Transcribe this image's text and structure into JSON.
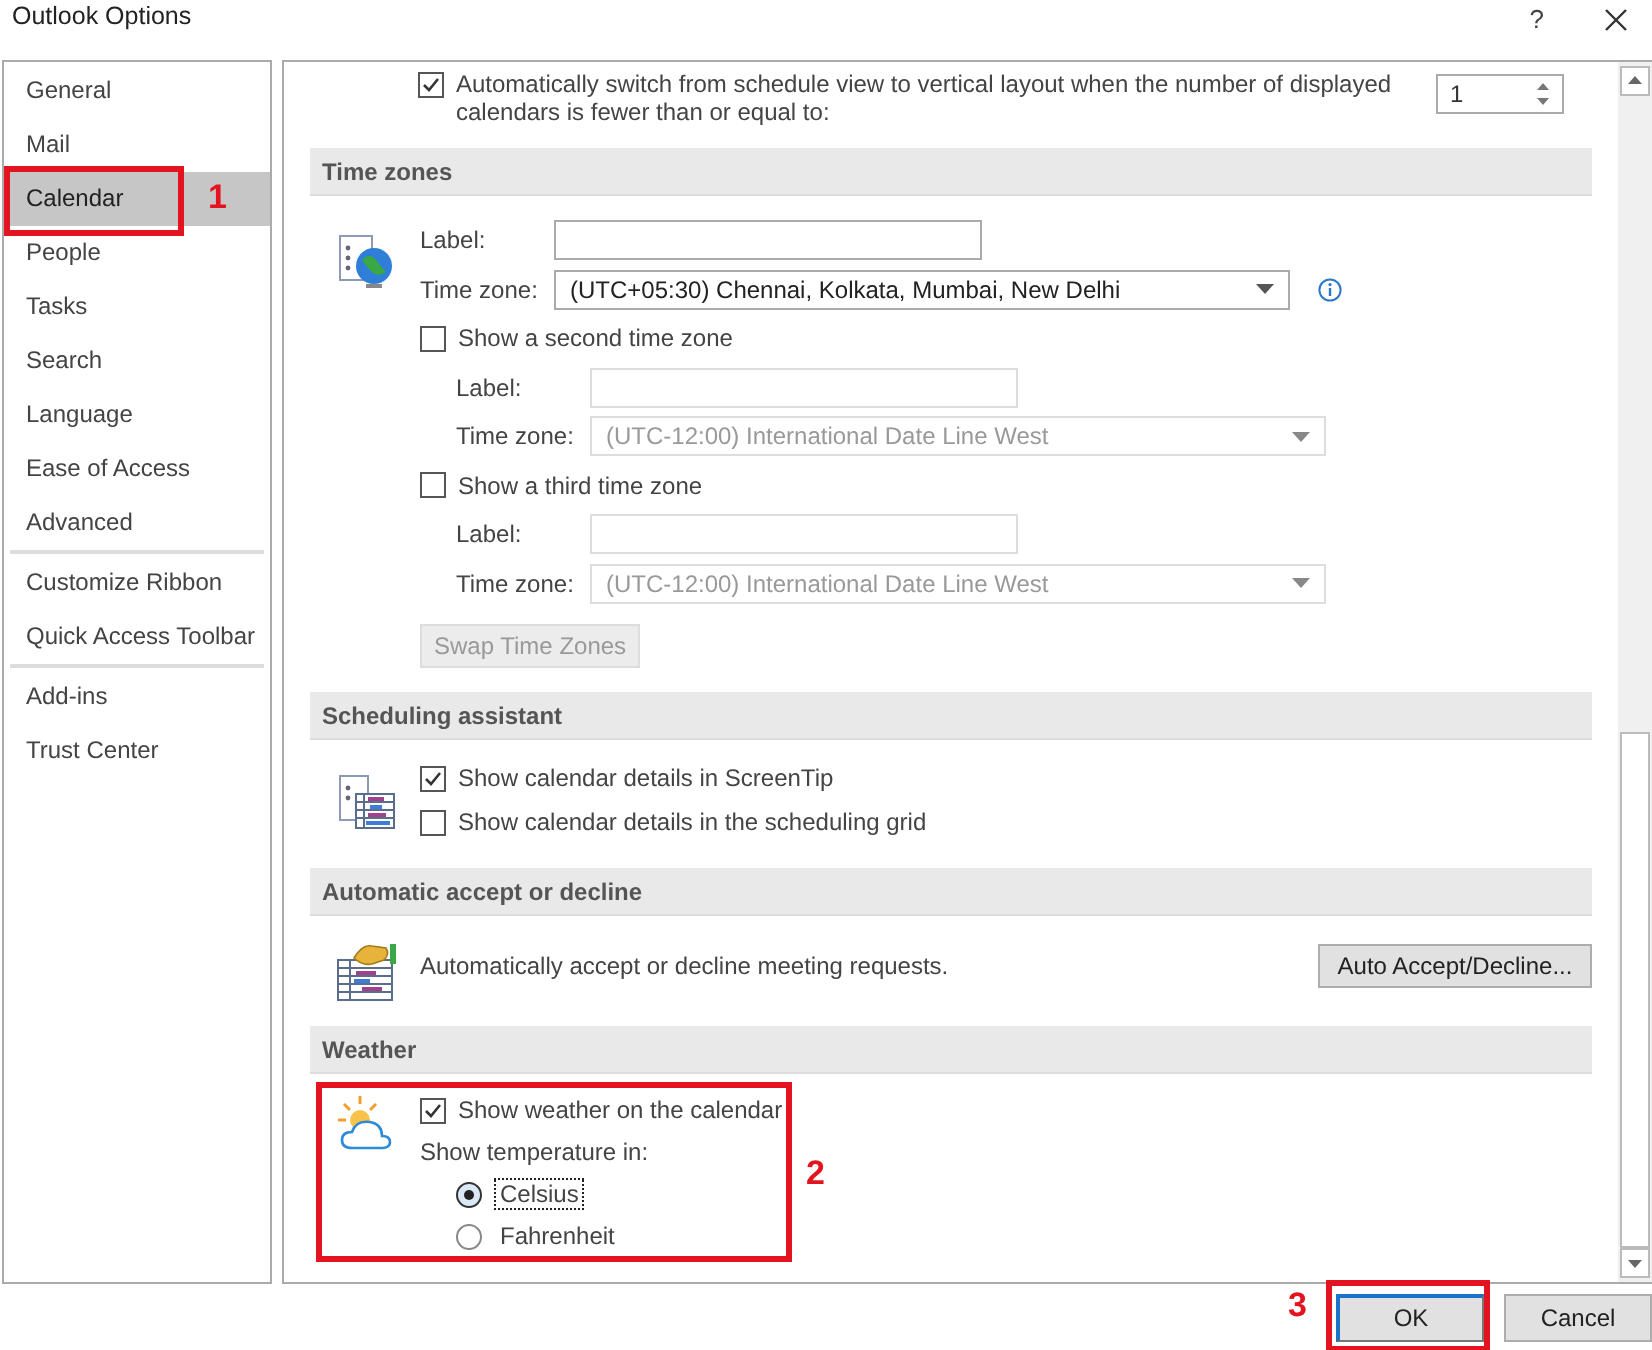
{
  "window": {
    "title": "Outlook Options",
    "help": "?"
  },
  "sidebar": {
    "groups": [
      [
        {
          "label": "General",
          "selected": false
        },
        {
          "label": "Mail",
          "selected": false
        },
        {
          "label": "Calendar",
          "selected": true,
          "annotation": "1"
        },
        {
          "label": "People",
          "selected": false
        },
        {
          "label": "Tasks",
          "selected": false
        },
        {
          "label": "Search",
          "selected": false
        },
        {
          "label": "Language",
          "selected": false
        },
        {
          "label": "Ease of Access",
          "selected": false
        },
        {
          "label": "Advanced",
          "selected": false
        }
      ],
      [
        {
          "label": "Customize Ribbon",
          "selected": false
        },
        {
          "label": "Quick Access Toolbar",
          "selected": false
        }
      ],
      [
        {
          "label": "Add-ins",
          "selected": false
        },
        {
          "label": "Trust Center",
          "selected": false
        }
      ]
    ]
  },
  "top_option": {
    "label": "Automatically switch from schedule view to vertical layout when the number of displayed calendars is fewer than or equal to:",
    "checked": true,
    "spinner": "1"
  },
  "sections": [
    {
      "title": "Time zones",
      "rows": [
        {
          "kind": "field",
          "label": "Label:",
          "disabled": false
        },
        {
          "kind": "select",
          "label": "Time zone:",
          "value": "(UTC+05:30) Chennai, Kolkata, Mumbai, New Delhi",
          "disabled": false,
          "info": true
        },
        {
          "kind": "checkbox",
          "label": "Show a second time zone",
          "checked": false,
          "children": [
            {
              "kind": "field",
              "label": "Label:",
              "disabled": true
            },
            {
              "kind": "select",
              "label": "Time zone:",
              "value": "(UTC-12:00) International Date Line West",
              "disabled": true
            }
          ]
        },
        {
          "kind": "checkbox",
          "label": "Show a third time zone",
          "checked": false,
          "children": [
            {
              "kind": "field",
              "label": "Label:",
              "disabled": true
            },
            {
              "kind": "select",
              "label": "Time zone:",
              "value": "(UTC-12:00) International Date Line West",
              "disabled": true
            }
          ]
        },
        {
          "kind": "button",
          "label": "Swap Time Zones",
          "disabled": true
        }
      ]
    },
    {
      "title": "Scheduling assistant",
      "rows": [
        {
          "kind": "checkbox",
          "label": "Show calendar details in ScreenTip",
          "checked": true
        },
        {
          "kind": "checkbox",
          "label": "Show calendar details in the scheduling grid",
          "checked": false
        }
      ]
    },
    {
      "title": "Automatic accept or decline",
      "rows": [
        {
          "kind": "text",
          "label": "Automatically accept or decline meeting requests.",
          "button": "Auto Accept/Decline..."
        }
      ]
    },
    {
      "title": "Weather",
      "annotation": "2",
      "rows": [
        {
          "kind": "checkbox",
          "label": "Show weather on the calendar",
          "checked": true
        },
        {
          "kind": "text",
          "label": "Show temperature in:",
          "children": [
            {
              "kind": "radio",
              "label": "Celsius",
              "selected": true,
              "focused": true
            },
            {
              "kind": "radio",
              "label": "Fahrenheit",
              "selected": false,
              "focused": false
            }
          ]
        }
      ]
    }
  ],
  "footer": {
    "buttons": [
      {
        "label": "OK",
        "default": true,
        "annotation": "3"
      },
      {
        "label": "Cancel",
        "default": false
      }
    ]
  }
}
